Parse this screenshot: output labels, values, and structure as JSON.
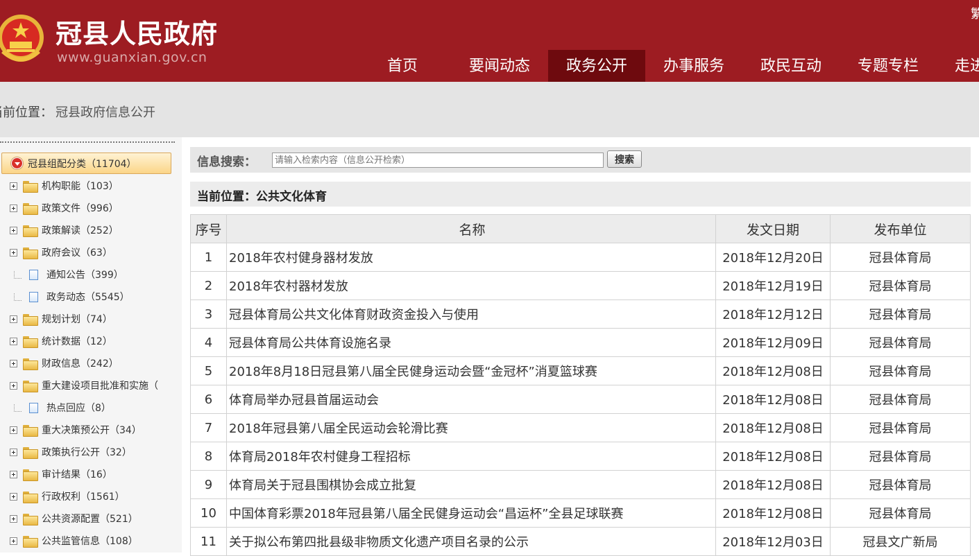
{
  "header": {
    "site_title": "冠县人民政府",
    "site_url": "www.guanxian.gov.cn",
    "corner_text": "繁"
  },
  "nav": {
    "items": [
      "首页",
      "要闻动态",
      "政务公开",
      "办事服务",
      "政民互动",
      "专题专栏",
      "走进冠县"
    ],
    "active_index": 2
  },
  "breadcrumb": {
    "label": "当前位置：",
    "link": "冠县政府信息公开"
  },
  "sidebar": {
    "root": "冠县组配分类（11704）",
    "items": [
      {
        "label": "机构职能（103）",
        "type": "folder"
      },
      {
        "label": "政策文件（996）",
        "type": "folder"
      },
      {
        "label": "政策解读（252）",
        "type": "folder"
      },
      {
        "label": "政府会议（63）",
        "type": "folder"
      },
      {
        "label": "通知公告（399）",
        "type": "doc"
      },
      {
        "label": "政务动态（5545）",
        "type": "doc"
      },
      {
        "label": "规划计划（74）",
        "type": "folder"
      },
      {
        "label": "统计数据（12）",
        "type": "folder"
      },
      {
        "label": "财政信息（242）",
        "type": "folder"
      },
      {
        "label": "重大建设项目批准和实施（",
        "type": "folder"
      },
      {
        "label": "热点回应（8）",
        "type": "doc"
      },
      {
        "label": "重大决策预公开（34）",
        "type": "folder"
      },
      {
        "label": "政策执行公开（32）",
        "type": "folder"
      },
      {
        "label": "审计结果（16）",
        "type": "folder"
      },
      {
        "label": "行政权利（1561）",
        "type": "folder"
      },
      {
        "label": "公共资源配置（521）",
        "type": "folder"
      },
      {
        "label": "公共监管信息（108）",
        "type": "folder"
      }
    ]
  },
  "search": {
    "label": "信息搜索：",
    "placeholder": "请输入检索内容（信息公开检索）",
    "button": "搜索"
  },
  "section": {
    "title": "当前位置：公共文化体育"
  },
  "table": {
    "headers": [
      "序号",
      "名称",
      "发文日期",
      "发布单位"
    ],
    "rows": [
      {
        "no": "1",
        "name": "2018年农村健身器材发放",
        "date": "2018年12月20日",
        "unit": "冠县体育局"
      },
      {
        "no": "2",
        "name": "2018年农村器材发放",
        "date": "2018年12月19日",
        "unit": "冠县体育局"
      },
      {
        "no": "3",
        "name": "冠县体育局公共文化体育财政资金投入与使用",
        "date": "2018年12月12日",
        "unit": "冠县体育局"
      },
      {
        "no": "4",
        "name": "冠县体育局公共体育设施名录",
        "date": "2018年12月09日",
        "unit": "冠县体育局"
      },
      {
        "no": "5",
        "name": "2018年8月18日冠县第八届全民健身运动会暨“金冠杯”消夏篮球赛",
        "date": "2018年12月08日",
        "unit": "冠县体育局"
      },
      {
        "no": "6",
        "name": "体育局举办冠县首届运动会",
        "date": "2018年12月08日",
        "unit": "冠县体育局"
      },
      {
        "no": "7",
        "name": "2018年冠县第八届全民运动会轮滑比赛",
        "date": "2018年12月08日",
        "unit": "冠县体育局"
      },
      {
        "no": "8",
        "name": "体育局2018年农村健身工程招标",
        "date": "2018年12月08日",
        "unit": "冠县体育局"
      },
      {
        "no": "9",
        "name": "体育局关于冠县围棋协会成立批复",
        "date": "2018年12月08日",
        "unit": "冠县体育局"
      },
      {
        "no": "10",
        "name": "中国体育彩票2018年冠县第八届全民健身运动会“昌运杯”全县足球联赛",
        "date": "2018年12月08日",
        "unit": "冠县体育局"
      },
      {
        "no": "11",
        "name": "关于拟公布第四批县级非物质文化遗产项目名录的公示",
        "date": "2018年12月03日",
        "unit": "冠县文广新局"
      }
    ]
  },
  "colors": {
    "header_bg": "#9d1c22",
    "nav_active_bg": "#6e0a0e",
    "crumb_bg": "#e4e4e4"
  }
}
